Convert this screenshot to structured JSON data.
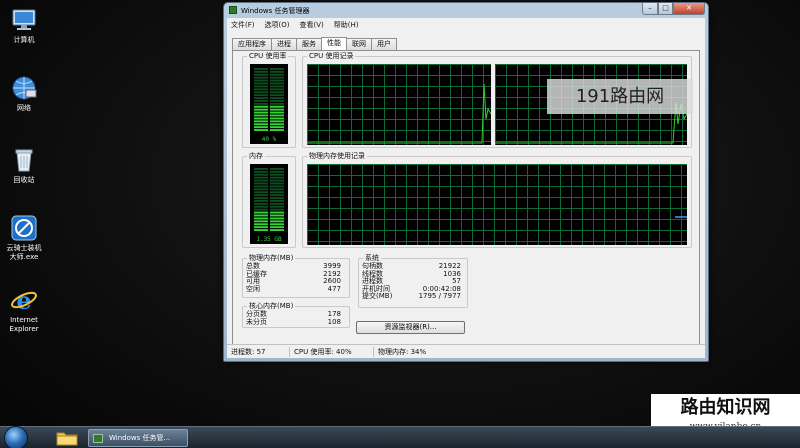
{
  "desktop": {
    "icons": [
      {
        "label": "计算机",
        "icon": "computer-icon"
      },
      {
        "label": "网络",
        "icon": "network-icon"
      },
      {
        "label": "回收站",
        "icon": "recycle-bin-icon"
      },
      {
        "label_line1": "云骑士装机",
        "label_line2": "大师.exe",
        "icon": "app-icon"
      },
      {
        "label_line1": "Internet",
        "label_line2": "Explorer",
        "icon": "ie-icon"
      }
    ]
  },
  "window": {
    "title": "Windows 任务管理器",
    "controls": {
      "minimize": "–",
      "maximize": "□",
      "close": "✕"
    },
    "menu": [
      "文件(F)",
      "选项(O)",
      "查看(V)",
      "帮助(H)"
    ],
    "tabs": [
      "应用程序",
      "进程",
      "服务",
      "性能",
      "联网",
      "用户"
    ],
    "active_tab": "性能",
    "cpu_usage": {
      "title": "CPU 使用率",
      "value": "40 %",
      "level": 0.4
    },
    "cpu_history": {
      "title": "CPU 使用记录"
    },
    "memory": {
      "title": "内存",
      "value": "1.35 GB",
      "level": 0.34
    },
    "memory_history": {
      "title": "物理内存使用记录"
    },
    "physical_memory": {
      "title": "物理内存(MB)",
      "rows": [
        {
          "label": "总数",
          "value": "3999"
        },
        {
          "label": "已缓存",
          "value": "2192"
        },
        {
          "label": "可用",
          "value": "2600"
        },
        {
          "label": "空闲",
          "value": "477"
        }
      ]
    },
    "kernel_memory": {
      "title": "核心内存(MB)",
      "rows": [
        {
          "label": "分页数",
          "value": "178"
        },
        {
          "label": "未分页",
          "value": "108"
        }
      ]
    },
    "system": {
      "title": "系统",
      "rows": [
        {
          "label": "句柄数",
          "value": "21922"
        },
        {
          "label": "线程数",
          "value": "1036"
        },
        {
          "label": "进程数",
          "value": "57"
        },
        {
          "label": "开机时间",
          "value": "0:00:42:08"
        },
        {
          "label": "提交(MB)",
          "value": "1795 / 7977"
        }
      ]
    },
    "resource_monitor_button": "资源监视器(R)...",
    "status": {
      "processes": "进程数: 57",
      "cpu": "CPU 使用率: 40%",
      "memory": "物理内存: 34%"
    }
  },
  "taskbar": {
    "active_app": "Windows 任务管..."
  },
  "watermarks": {
    "top": "191路由网",
    "bottom_main": "路由知识网",
    "bottom_url": "www.yilanbo.cn"
  },
  "colors": {
    "graph_line": "#2fd12f",
    "grid": "#0c6a36",
    "meter_on": "#33d433",
    "meter_off": "#0d4d1f"
  }
}
